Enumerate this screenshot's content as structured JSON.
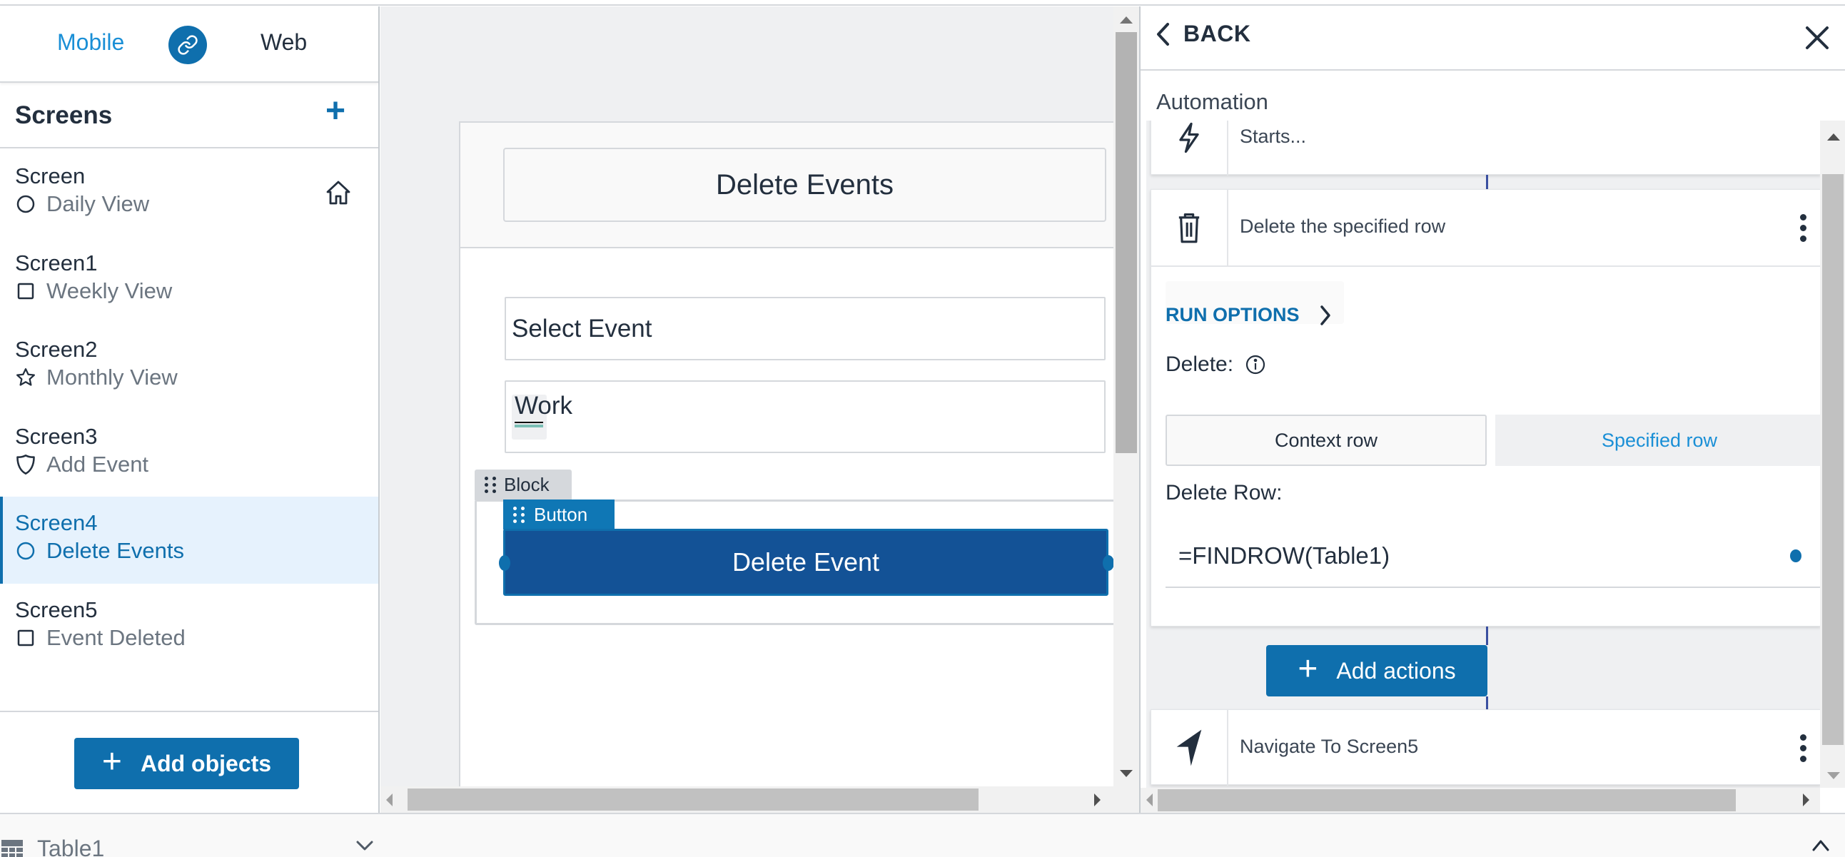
{
  "mode_bar": {
    "mobile_label": "Mobile",
    "web_label": "Web",
    "link_icon": "link-icon",
    "active_mode": "Mobile"
  },
  "sidebar": {
    "title": "Screens",
    "add_icon": "plus-icon",
    "screens": [
      {
        "name": "Screen",
        "subtitle": "Daily View",
        "icon": "circle-icon",
        "is_home": true,
        "selected": false
      },
      {
        "name": "Screen1",
        "subtitle": "Weekly View",
        "icon": "square-icon",
        "is_home": false,
        "selected": false
      },
      {
        "name": "Screen2",
        "subtitle": "Monthly View",
        "icon": "star-icon",
        "is_home": false,
        "selected": false
      },
      {
        "name": "Screen3",
        "subtitle": "Add Event",
        "icon": "shield-icon",
        "is_home": false,
        "selected": false
      },
      {
        "name": "Screen4",
        "subtitle": "Delete Events",
        "icon": "circle-icon",
        "is_home": false,
        "selected": true
      },
      {
        "name": "Screen5",
        "subtitle": "Event Deleted",
        "icon": "square-icon",
        "is_home": false,
        "selected": false
      }
    ],
    "add_objects_label": "Add objects"
  },
  "canvas": {
    "title": "Delete Events",
    "select_field_label": "Select Event",
    "work_field_value": "Work",
    "block_tag": "Block",
    "button_tag": "Button",
    "button_label": "Delete Event"
  },
  "bottom_bar": {
    "table_name": "Table1"
  },
  "right_panel": {
    "back_label": "BACK",
    "section_label": "Automation",
    "steps": [
      {
        "icon": "lightning-icon",
        "label": "Starts..."
      },
      {
        "icon": "trash-icon",
        "label": "Delete the specified row"
      },
      {
        "icon": "navigate-arrow-icon",
        "label": "Navigate To Screen5"
      }
    ],
    "run_options_label": "RUN OPTIONS",
    "delete_label": "Delete:",
    "delete_options": [
      "Context row",
      "Specified row"
    ],
    "delete_selected": "Specified row",
    "delete_row_label": "Delete Row:",
    "delete_row_formula": "=FINDROW(Table1)",
    "add_actions_label": "Add actions"
  },
  "colors": {
    "accent": "#0f6fad",
    "accent_light": "#1a8fd6",
    "selected_bg": "#e6f2fd",
    "button_fill": "#135296",
    "text": "#232f3e",
    "canvas_bg": "#eff0f2"
  }
}
